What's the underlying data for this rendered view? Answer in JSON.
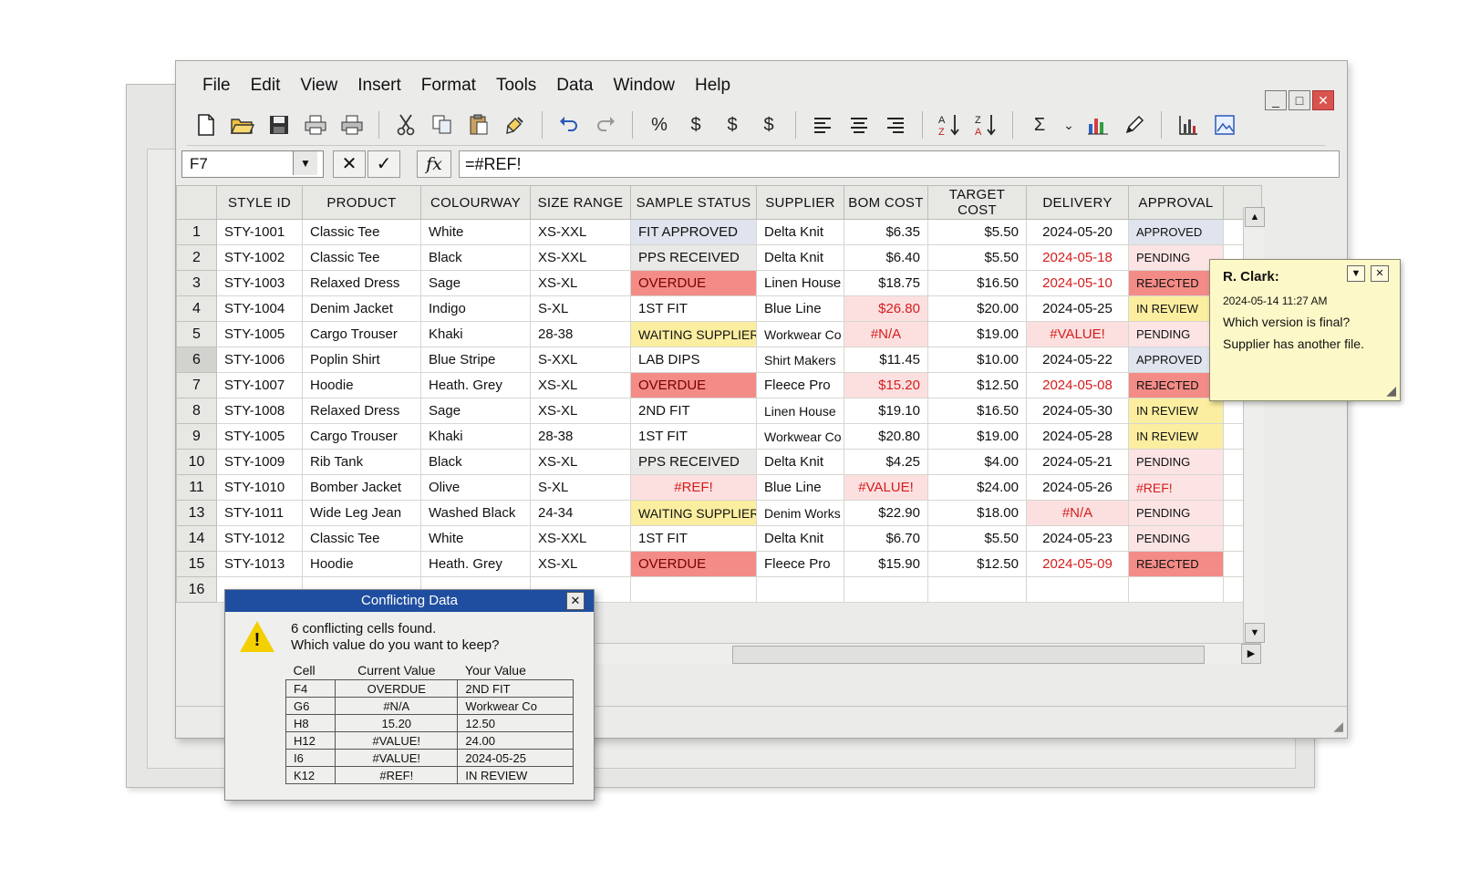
{
  "menu": [
    "File",
    "Edit",
    "View",
    "Insert",
    "Format",
    "Tools",
    "Data",
    "Window",
    "Help"
  ],
  "window_controls": {
    "minimize": "_",
    "maximize": "□",
    "close": "✕"
  },
  "toolbar": {
    "percent": "%",
    "dollar1": "$",
    "dollar2": "$",
    "dollar3": "$",
    "sigma": "Σ",
    "sigma_arrow": "⌄",
    "icons": [
      "new-file-icon",
      "open-folder-icon",
      "save-icon",
      "print-icon",
      "print-preview-icon",
      "cut-icon",
      "copy-icon",
      "paste-icon",
      "format-painter-icon",
      "undo-icon",
      "redo-icon",
      "align-left-icon",
      "align-center-icon",
      "align-right-icon",
      "sort-asc-icon",
      "sort-desc-icon",
      "chart-icon",
      "draw-icon",
      "chart-wizard-icon",
      "image-icon"
    ]
  },
  "formula_bar": {
    "cell_ref": "F7",
    "cancel": "✕",
    "confirm": "✓",
    "fx": "fx",
    "formula": "=#REF!"
  },
  "columns": [
    "STYLE ID",
    "PRODUCT",
    "COLOURWAY",
    "SIZE RANGE",
    "SAMPLE STATUS",
    "SUPPLIER",
    "BOM COST",
    "TARGET COST",
    "DELIVERY",
    "APPROVAL"
  ],
  "rows": [
    {
      "n": "1",
      "id": "STY-1001",
      "product": "Classic Tee",
      "colour": "White",
      "size": "XS-XXL",
      "status": "FIT APPROVED",
      "supplier": "Delta Knit",
      "bom": "$6.35",
      "target": "$5.50",
      "delivery": "2024-05-20",
      "approval": "APPROVED"
    },
    {
      "n": "2",
      "id": "STY-1002",
      "product": "Classic Tee",
      "colour": "Black",
      "size": "XS-XXL",
      "status": "PPS RECEIVED",
      "supplier": "Delta Knit",
      "bom": "$6.40",
      "target": "$5.50",
      "delivery": "2024-05-18",
      "approval": "PENDING"
    },
    {
      "n": "3",
      "id": "STY-1003",
      "product": "Relaxed Dress",
      "colour": "Sage",
      "size": "XS-XL",
      "status": "OVERDUE",
      "supplier": "Linen House",
      "bom": "$18.75",
      "target": "$16.50",
      "delivery": "2024-05-10",
      "approval": "REJECTED"
    },
    {
      "n": "4",
      "id": "STY-1004",
      "product": "Denim Jacket",
      "colour": "Indigo",
      "size": "S-XL",
      "status": "1ST FIT",
      "supplier": "Blue Line",
      "bom": "$26.80",
      "target": "$20.00",
      "delivery": "2024-05-25",
      "approval": "IN REVIEW"
    },
    {
      "n": "5",
      "id": "STY-1005",
      "product": "Cargo Trouser",
      "colour": "Khaki",
      "size": "28-38",
      "status": "WAITING SUPPLIER",
      "supplier": "Workwear Co",
      "bom": "#N/A",
      "target": "$19.00",
      "delivery": "#VALUE!",
      "approval": "PENDING"
    },
    {
      "n": "6",
      "id": "STY-1006",
      "product": "Poplin Shirt",
      "colour": "Blue Stripe",
      "size": "S-XXL",
      "status": "LAB DIPS",
      "supplier": "Shirt Makers",
      "bom": "$11.45",
      "target": "$10.00",
      "delivery": "2024-05-22",
      "approval": "APPROVED"
    },
    {
      "n": "7",
      "id": "STY-1007",
      "product": "Hoodie",
      "colour": "Heath. Grey",
      "size": "XS-XL",
      "status": "OVERDUE",
      "supplier": "Fleece Pro",
      "bom": "$15.20",
      "target": "$12.50",
      "delivery": "2024-05-08",
      "approval": "REJECTED"
    },
    {
      "n": "8",
      "id": "STY-1008",
      "product": "Relaxed Dress",
      "colour": "Sage",
      "size": "XS-XL",
      "status": "2ND FIT",
      "supplier": "Linen House",
      "bom": "$19.10",
      "target": "$16.50",
      "delivery": "2024-05-30",
      "approval": "IN REVIEW"
    },
    {
      "n": "9",
      "id": "STY-1005",
      "product": "Cargo Trouser",
      "colour": "Khaki",
      "size": "28-38",
      "status": "1ST FIT",
      "supplier": "Workwear Co",
      "bom": "$20.80",
      "target": "$19.00",
      "delivery": "2024-05-28",
      "approval": "IN REVIEW"
    },
    {
      "n": "10",
      "id": "STY-1009",
      "product": "Rib Tank",
      "colour": "Black",
      "size": "XS-XL",
      "status": "PPS RECEIVED",
      "supplier": "Delta Knit",
      "bom": "$4.25",
      "target": "$4.00",
      "delivery": "2024-05-21",
      "approval": "PENDING"
    },
    {
      "n": "11",
      "id": "STY-1010",
      "product": "Bomber Jacket",
      "colour": "Olive",
      "size": "S-XL",
      "status": "#REF!",
      "supplier": "Blue Line",
      "bom": "#VALUE!",
      "target": "$24.00",
      "delivery": "2024-05-26",
      "approval": "#REF!"
    },
    {
      "n": "13",
      "id": "STY-1011",
      "product": "Wide Leg Jean",
      "colour": "Washed Black",
      "size": "24-34",
      "status": "WAITING SUPPLIER",
      "supplier": "Denim Works",
      "bom": "$22.90",
      "target": "$18.00",
      "delivery": "#N/A",
      "approval": "PENDING"
    },
    {
      "n": "14",
      "id": "STY-1012",
      "product": "Classic Tee",
      "colour": "White",
      "size": "XS-XXL",
      "status": "1ST FIT",
      "supplier": "Delta Knit",
      "bom": "$6.70",
      "target": "$5.50",
      "delivery": "2024-05-23",
      "approval": "PENDING"
    },
    {
      "n": "15",
      "id": "STY-1013",
      "product": "Hoodie",
      "colour": "Heath. Grey",
      "size": "XS-XL",
      "status": "OVERDUE",
      "supplier": "Fleece Pro",
      "bom": "$15.90",
      "target": "$12.50",
      "delivery": "2024-05-09",
      "approval": "REJECTED"
    },
    {
      "n": "16",
      "id": "",
      "product": "",
      "colour": "",
      "size": "",
      "status": "",
      "supplier": "",
      "bom": "",
      "target": "",
      "delivery": "",
      "approval": ""
    }
  ],
  "comment": {
    "author": "R. Clark:",
    "time": "2024-05-14 11:27 AM",
    "line1": "Which version is final?",
    "line2": "Supplier has another file."
  },
  "dialog": {
    "title": "Conflicting Data",
    "message1": "6 conflicting cells found.",
    "message2": "Which value do you want to keep?",
    "headers": [
      "Cell",
      "Current Value",
      "Your Value"
    ],
    "rows": [
      [
        "F4",
        "OVERDUE",
        "2ND FIT"
      ],
      [
        "G6",
        "#N/A",
        "Workwear Co"
      ],
      [
        "H8",
        "15.20",
        "12.50"
      ],
      [
        "H12",
        "#VALUE!",
        "24.00"
      ],
      [
        "I6",
        "#VALUE!",
        "2024-05-25"
      ],
      [
        "K12",
        "#REF!",
        "IN REVIEW"
      ]
    ]
  }
}
